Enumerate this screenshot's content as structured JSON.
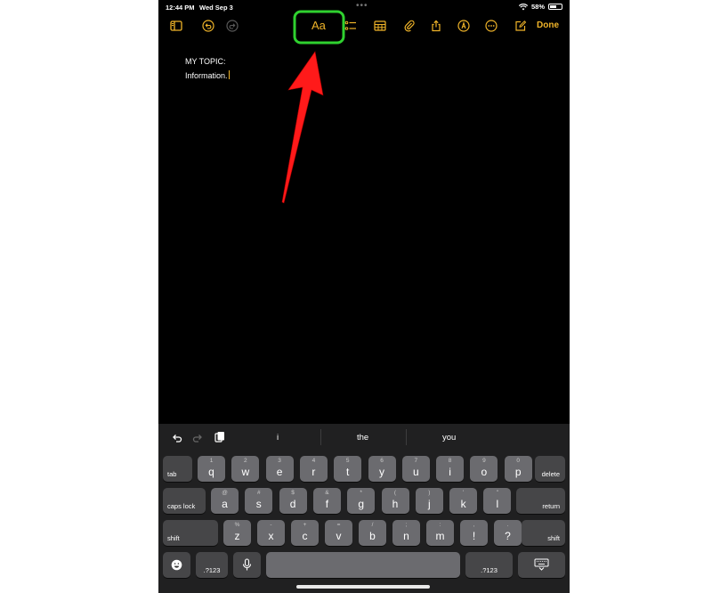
{
  "status_bar": {
    "time": "12:44 PM",
    "date": "Wed Sep 3",
    "battery_percent": "58%",
    "battery_level": 0.58
  },
  "toolbar": {
    "format_label": "Aa",
    "done_label": "Done"
  },
  "note": {
    "line1": "MY TOPIC:",
    "line2": "Information."
  },
  "suggestions": [
    "i",
    "the",
    "you"
  ],
  "keyboard": {
    "row1": [
      {
        "main": "q",
        "hint": "1"
      },
      {
        "main": "w",
        "hint": "2"
      },
      {
        "main": "e",
        "hint": "3"
      },
      {
        "main": "r",
        "hint": "4"
      },
      {
        "main": "t",
        "hint": "5"
      },
      {
        "main": "y",
        "hint": "6"
      },
      {
        "main": "u",
        "hint": "7"
      },
      {
        "main": "i",
        "hint": "8"
      },
      {
        "main": "o",
        "hint": "9"
      },
      {
        "main": "p",
        "hint": "0"
      }
    ],
    "row2": [
      {
        "main": "a",
        "hint": "@"
      },
      {
        "main": "s",
        "hint": "#"
      },
      {
        "main": "d",
        "hint": "$"
      },
      {
        "main": "f",
        "hint": "&"
      },
      {
        "main": "g",
        "hint": "*"
      },
      {
        "main": "h",
        "hint": "("
      },
      {
        "main": "j",
        "hint": ")"
      },
      {
        "main": "k",
        "hint": "'"
      },
      {
        "main": "l",
        "hint": "\""
      }
    ],
    "row3": [
      {
        "main": "z",
        "hint": "%"
      },
      {
        "main": "x",
        "hint": "-"
      },
      {
        "main": "c",
        "hint": "+"
      },
      {
        "main": "v",
        "hint": "="
      },
      {
        "main": "b",
        "hint": "/"
      },
      {
        "main": "n",
        "hint": ";"
      },
      {
        "main": "m",
        "hint": ":"
      },
      {
        "main": "!",
        "hint": ","
      },
      {
        "main": "?",
        "hint": "."
      }
    ],
    "tab_label": "tab",
    "delete_label": "delete",
    "caps_label": "caps lock",
    "return_label": "return",
    "shift_label": "shift",
    "numbers_label": ".?123"
  },
  "colors": {
    "accent": "#f0b429",
    "highlight": "#2fd12f",
    "arrow": "#ff1a1a"
  },
  "icons": [
    "sidebar-icon",
    "undo-icon",
    "redo-icon",
    "checklist-icon",
    "table-icon",
    "attachment-icon",
    "share-icon",
    "markup-icon",
    "more-icon",
    "compose-icon",
    "wifi-icon",
    "battery-icon",
    "emoji-icon",
    "microphone-icon",
    "keyboard-dismiss-icon",
    "paste-icon"
  ]
}
